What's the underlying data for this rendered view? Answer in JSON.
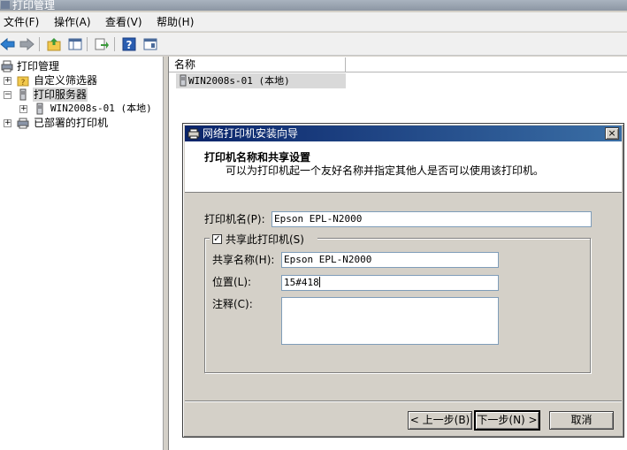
{
  "window": {
    "title": "打印管理"
  },
  "menu": [
    "文件(F)",
    "操作(A)",
    "查看(V)",
    "帮助(H)"
  ],
  "toolbar": {
    "icons": [
      "back-arrow-icon",
      "forward-arrow-icon",
      "up-folder-icon",
      "show-hide-tree-icon",
      "export-list-icon",
      "help-icon",
      "properties-icon"
    ]
  },
  "tree": {
    "root": "打印管理",
    "items": [
      "自定义筛选器",
      "打印服务器",
      "WIN2008s-01 (本地)",
      "已部署的打印机"
    ]
  },
  "list": {
    "column_name": "名称",
    "rows": [
      "WIN2008s-01 (本地)"
    ]
  },
  "dialog": {
    "title": "网络打印机安装向导",
    "header_title": "打印机名称和共享设置",
    "header_subtitle": "可以为打印机起一个友好名称并指定其他人是否可以使用该打印机。",
    "printer_name_label": "打印机名(P):",
    "printer_name_value": "Epson EPL-N2000",
    "share_checkbox_label": "共享此打印机(S)",
    "share_checked": true,
    "share_name_label": "共享名称(H):",
    "share_name_value": "Epson EPL-N2000",
    "location_label": "位置(L):",
    "location_value": "15#418",
    "comment_label": "注释(C):",
    "comment_value": "",
    "back_button": "< 上一步(B)",
    "next_button": "下一步(N) >",
    "cancel_button": "取消",
    "close_glyph": "×"
  },
  "colors": {
    "dialog_title_start": "#0a246a",
    "dialog_title_end": "#3a6ea5",
    "selection": "#d9d9d9",
    "chrome": "#d4d0c8"
  }
}
